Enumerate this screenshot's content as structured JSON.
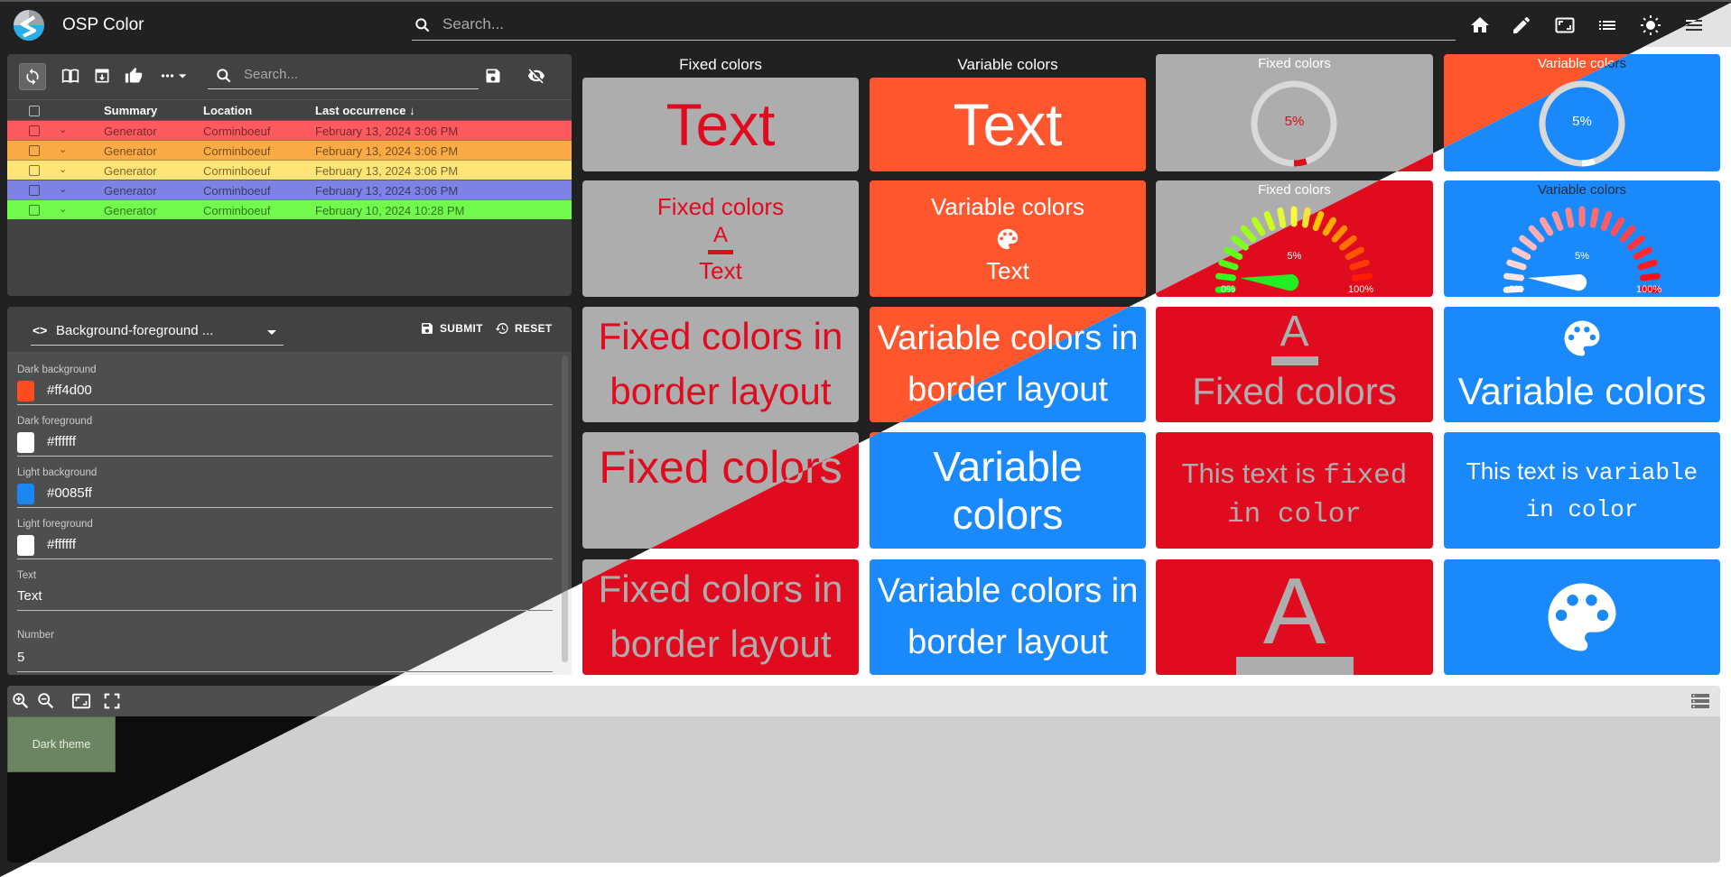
{
  "app": {
    "title": "OSP Color"
  },
  "header": {
    "search_placeholder": "Search...",
    "icons": [
      "home-icon",
      "edit-icon",
      "fit-screen-icon",
      "list-icon",
      "theme-toggle-icon",
      "menu-icon"
    ]
  },
  "alarms": {
    "toolbar": {
      "search_placeholder": "Search...",
      "icons": [
        "refresh-icon",
        "book-icon",
        "archive-icon",
        "acknowledge-icon",
        "more-icon",
        "save-icon",
        "visibility-off-icon"
      ]
    },
    "columns": [
      "Summary",
      "Location",
      "Last occurrence"
    ],
    "sort_indicator": "↓",
    "rows": [
      {
        "summary": "Generator",
        "location": "Corminboeuf",
        "last_occurrence": "February 13, 2024 3:06 PM",
        "severity_color": "#ff5a5f"
      },
      {
        "summary": "Generator",
        "location": "Corminboeuf",
        "last_occurrence": "February 13, 2024 3:06 PM",
        "severity_color": "#fbab45"
      },
      {
        "summary": "Generator",
        "location": "Corminboeuf",
        "last_occurrence": "February 13, 2024 3:06 PM",
        "severity_color": "#ffe576"
      },
      {
        "summary": "Generator",
        "location": "Corminboeuf",
        "last_occurrence": "February 13, 2024 3:06 PM",
        "severity_color": "#7d82e3"
      },
      {
        "summary": "Generator",
        "location": "Corminboeuf",
        "last_occurrence": "February 10, 2024 10:28 PM",
        "severity_color": "#71fa4b"
      }
    ]
  },
  "properties": {
    "selector": {
      "code_icon": "<>",
      "value": "Background-foreground ..."
    },
    "submit_label": "SUBMIT",
    "reset_label": "RESET",
    "fields": [
      {
        "label": "Dark background",
        "value": "#ff4d00",
        "swatch": "#ff4d1f"
      },
      {
        "label": "Dark foreground",
        "value": "#ffffff",
        "swatch": "#ffffff"
      },
      {
        "label": "Light background",
        "value": "#0085ff",
        "swatch": "#1a87f5"
      },
      {
        "label": "Light foreground",
        "value": "#ffffff",
        "swatch": "#ffffff"
      },
      {
        "label": "Text",
        "value": "Text"
      },
      {
        "label": "Number",
        "value": "5"
      }
    ]
  },
  "canvas": {
    "node_label": "Dark theme",
    "toolbar_icons": [
      "zoom-in-icon",
      "zoom-out-icon",
      "fit-icon",
      "fullscreen-icon"
    ]
  },
  "theme_colors": {
    "fixed_bg_dark": "#adadad",
    "fixed_fg_dark": "#e00b1f",
    "fixed_bg_light": "#e00b1f",
    "fixed_fg_light": "#adadad",
    "variable_bg_dark": "#ff562d",
    "variable_fg_dark": "#ffffff",
    "variable_bg_light": "#1a89fb",
    "variable_fg_light": "#ffffff"
  },
  "tiles": {
    "col_title_fixed": "Fixed colors",
    "col_title_variable": "Variable colors",
    "text_value": "Text",
    "fixed_colors": "Fixed colors",
    "variable_colors": "Variable colors",
    "fixed_border": "Fixed colors in border layout",
    "variable_border": "Variable colors in border layout",
    "variable_two_line_1": "Variable",
    "variable_two_line_2": "colors",
    "fixed_mono_a": "This text is ",
    "fixed_mono_b": "fixed",
    "fixed_mono_c": "in color",
    "variable_mono_a": "This text is ",
    "variable_mono_b": "variable",
    "variable_mono_c": "in color",
    "progress_value": "5%",
    "progress_fraction": 0.05,
    "gauge_value": "5%",
    "gauge_fraction": 0.05,
    "gauge_min": "0%",
    "gauge_max": "100%",
    "gauge_ticks": 19
  }
}
